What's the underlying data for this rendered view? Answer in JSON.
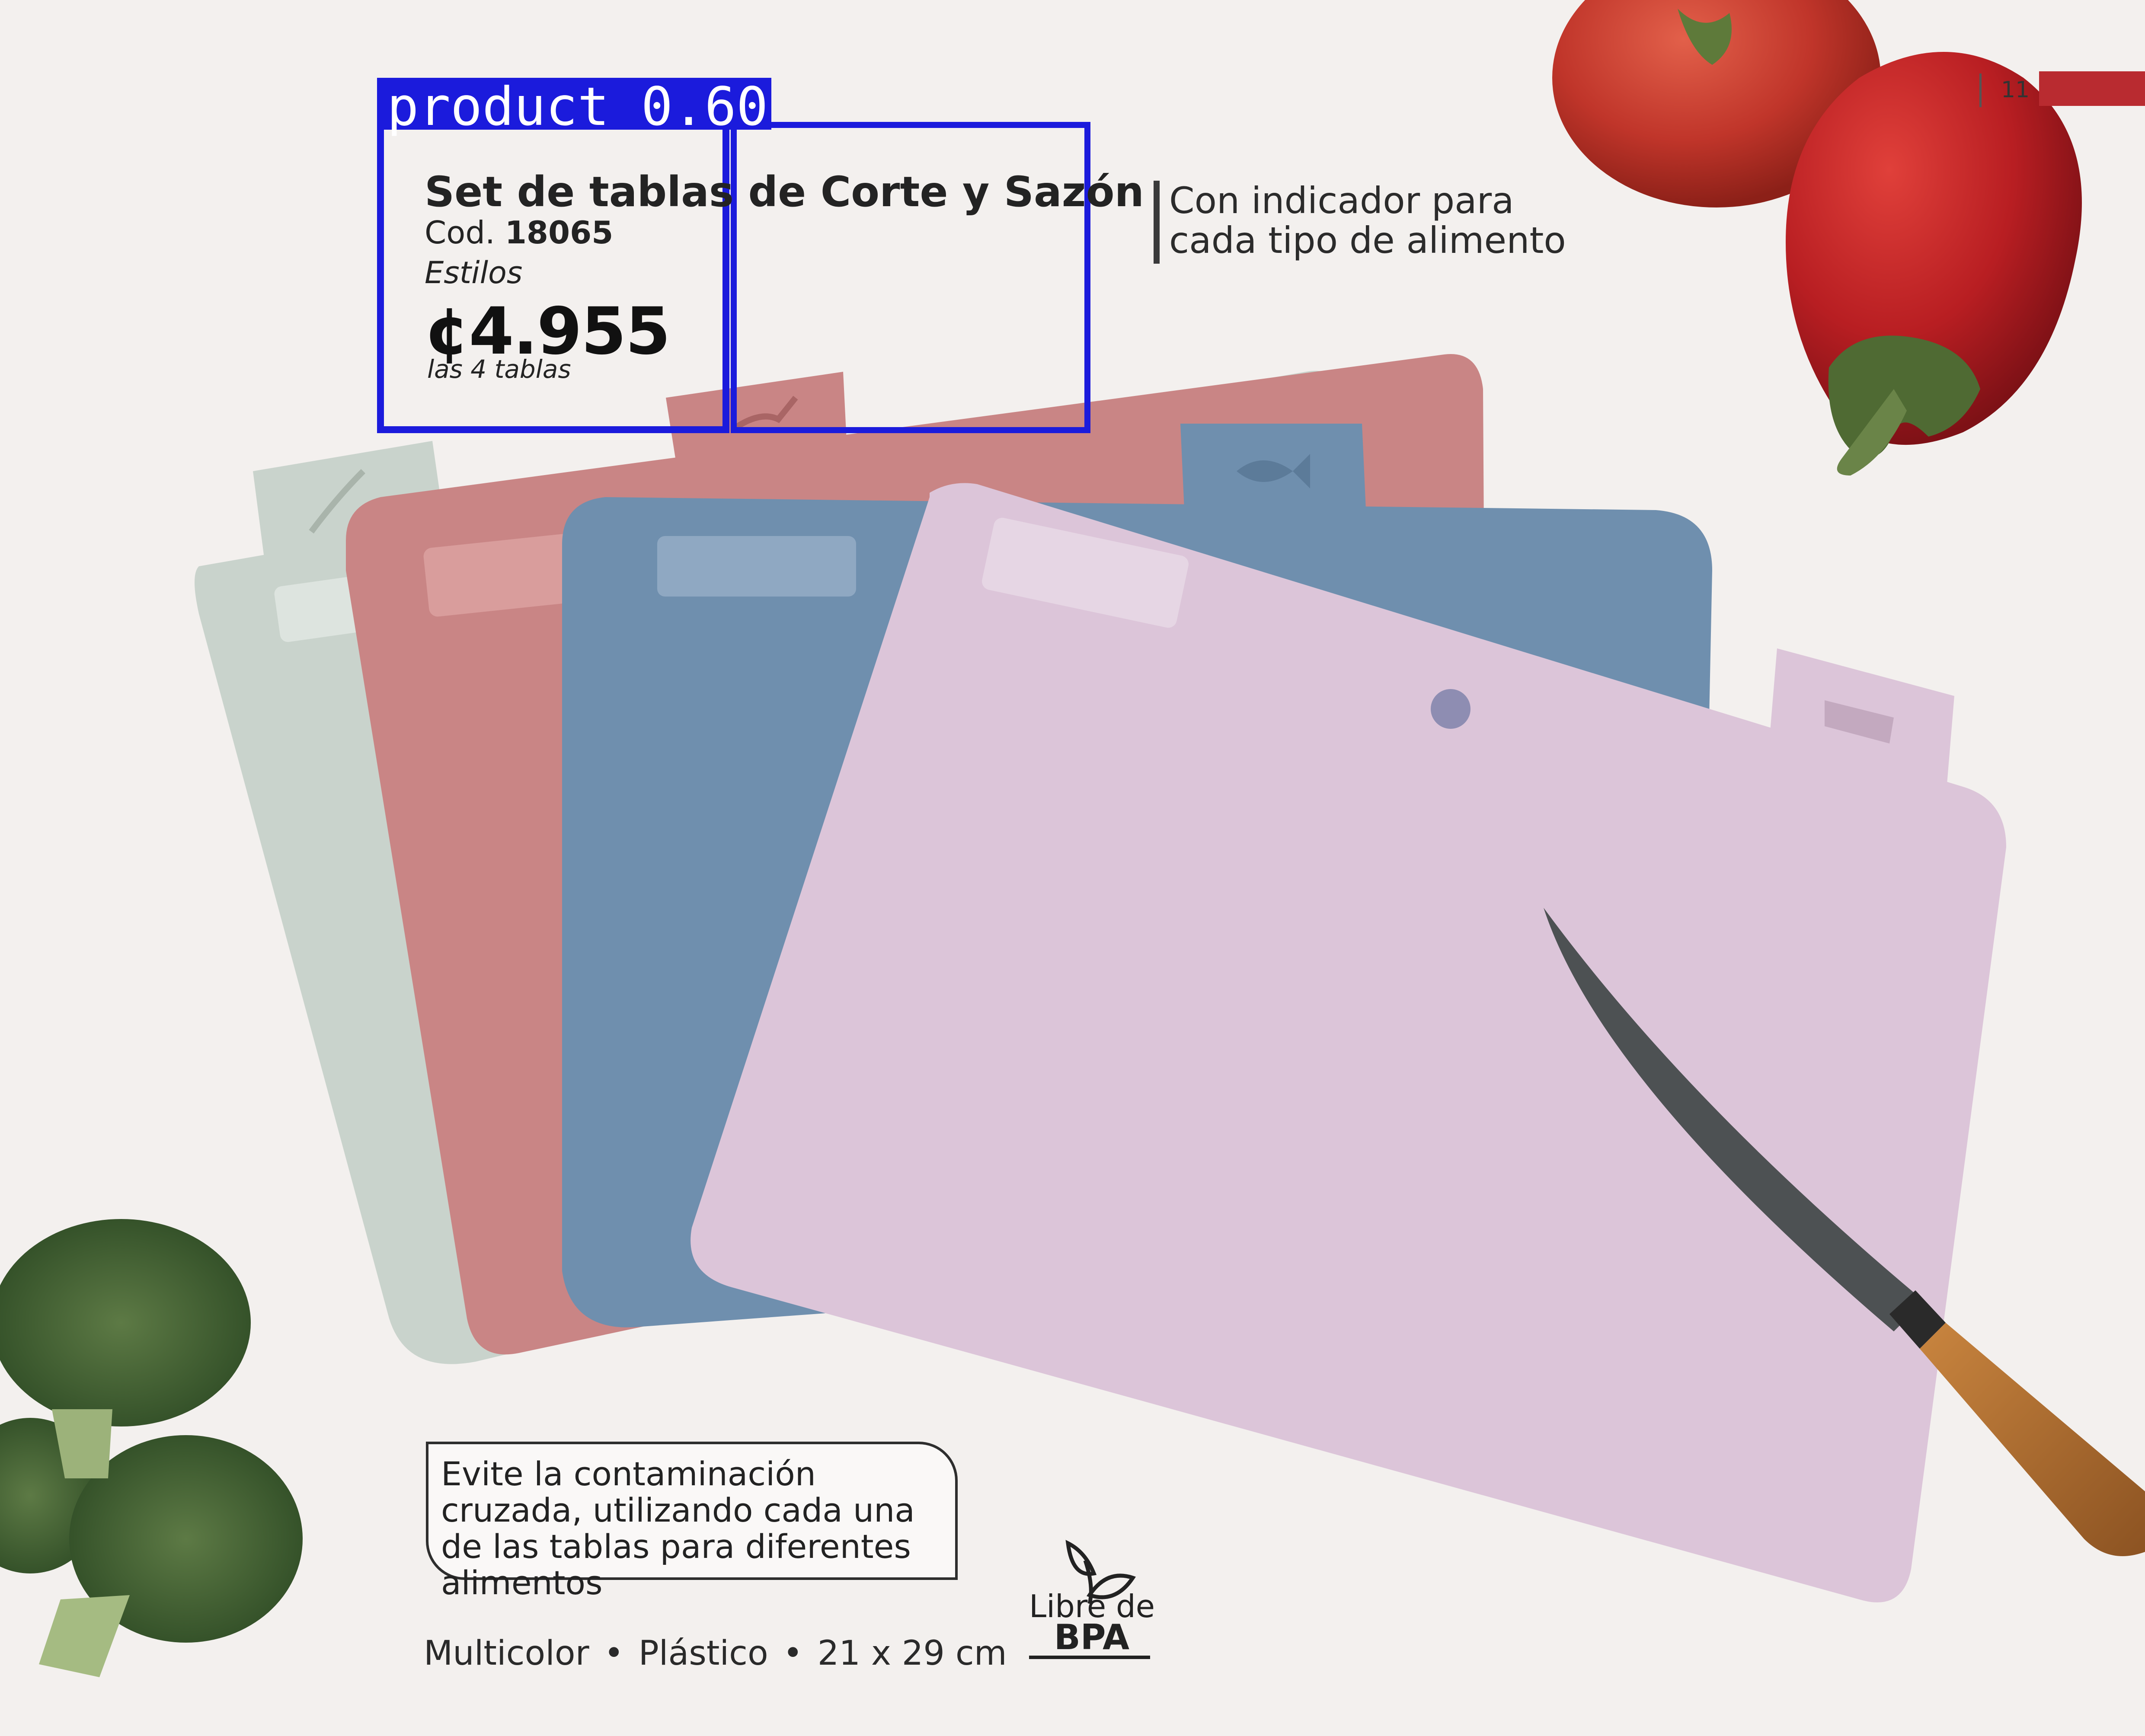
{
  "page": {
    "number": "11",
    "accent_color": "#b92b30",
    "background_color": "#f3f0ee"
  },
  "detection": {
    "label": "product 0.60",
    "color": "#1b1bdc"
  },
  "product": {
    "title": "Set de tablas de Corte y Sazón",
    "code_prefix": "Cod.",
    "code": "18065",
    "style": "Estilos",
    "price": "¢4.955",
    "price_note": "las 4 tablas"
  },
  "feature": {
    "line1": "Con indicador para",
    "line2": "cada tipo de alimento"
  },
  "note": {
    "text": "Evite la contaminación cruzada, utilizando cada una de las tablas para diferentes alimentos"
  },
  "specs": {
    "color": "Multicolor",
    "material": "Plástico",
    "size": "21 x 29 cm",
    "separator": "•"
  },
  "badge": {
    "line1": "Libre de",
    "line2": "BPA",
    "icon": "leaf-sprout-icon"
  },
  "boards": [
    {
      "name": "sage",
      "color": "#c9d3cc",
      "tab_icon": "carrot-icon"
    },
    {
      "name": "rose",
      "color": "#c98585",
      "tab_icon": "chicken-icon"
    },
    {
      "name": "blue",
      "color": "#6f8fae",
      "tab_icon": "fish-icon"
    },
    {
      "name": "lilac",
      "color": "#dcc5d9",
      "tab_icon": "cow-icon"
    }
  ]
}
